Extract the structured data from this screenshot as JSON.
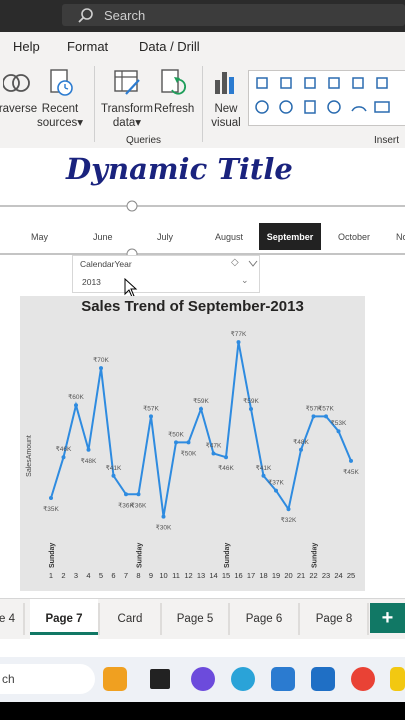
{
  "titlebar": {
    "search_placeholder": "Search"
  },
  "menu": {
    "items": [
      "Help",
      "Format",
      "Data / Drill"
    ]
  },
  "ribbon": {
    "buttons": {
      "traverse": "raverse",
      "recent_line1": "Recent",
      "recent_line2": "sources",
      "transform_line1": "Transform",
      "transform_line2": "data",
      "refresh": "Refresh",
      "new_visual_line1": "New",
      "new_visual_line2": "visual"
    },
    "groups": {
      "queries": "Queries",
      "insert": "Insert"
    }
  },
  "report": {
    "title": "Dynamic Title",
    "months": [
      "May",
      "June",
      "July",
      "August",
      "September",
      "October",
      "No"
    ],
    "selected_month": "September",
    "slicer": {
      "label": "CalendarYear",
      "value": "2013"
    }
  },
  "chart_data": {
    "type": "line",
    "title": "Sales Trend of September-2013",
    "ylabel": "SalesAmount",
    "x": [
      1,
      2,
      3,
      4,
      5,
      6,
      7,
      8,
      9,
      10,
      11,
      12,
      13,
      14,
      15,
      16,
      17,
      18,
      19,
      20,
      21,
      22,
      23,
      24,
      25
    ],
    "sunday_labels": [
      1,
      8,
      15,
      22
    ],
    "sunday_text": "Sunday",
    "series": [
      {
        "values": [
          35,
          46,
          60,
          48,
          70,
          41,
          36,
          36,
          57,
          30,
          50,
          50,
          59,
          47,
          46,
          77,
          59,
          41,
          37,
          32,
          48,
          57,
          57,
          53,
          45
        ]
      }
    ],
    "data_labels": [
      "₹35K",
      "₹46K",
      "₹60K",
      "₹48K",
      "₹70K",
      "₹41K",
      "₹36K",
      "₹36K",
      "₹57K",
      "₹30K",
      "₹50K",
      "₹50K",
      "₹59K",
      "₹47K",
      "₹46K",
      "₹77K",
      "₹59K",
      "₹41K",
      "₹37K",
      "₹32K",
      "₹48K",
      "₹57K",
      "₹57K",
      "₹53K",
      "₹45K"
    ],
    "ylim": [
      28,
      80
    ],
    "line_color": "#2e8be0"
  },
  "tabs": {
    "items": [
      "e 4",
      "Page 7",
      "Card",
      "Page 5",
      "Page 6",
      "Page 8"
    ],
    "active": "Page 7",
    "add_label": "+"
  },
  "taskbar": {
    "search_text": "ch"
  },
  "colors": {
    "accent": "#117865",
    "title": "#1a237e",
    "selected_month_bg": "#222222"
  }
}
